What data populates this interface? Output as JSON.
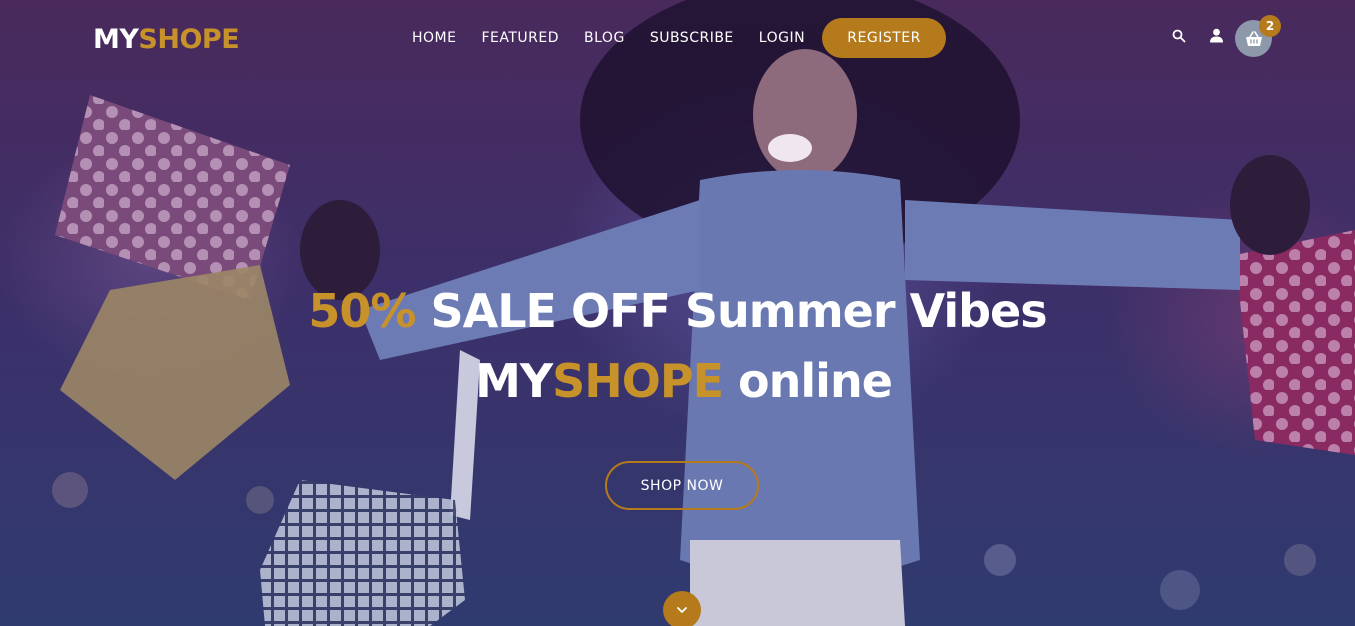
{
  "brand": {
    "part1": "MY",
    "part2": "SHOPE"
  },
  "nav": {
    "items": [
      {
        "label": "HOME"
      },
      {
        "label": "FEATURED"
      },
      {
        "label": "BLOG"
      },
      {
        "label": "SUBSCRIBE"
      },
      {
        "label": "LOGIN"
      }
    ],
    "register_label": "REGISTER"
  },
  "header_icons": {
    "search": "search-icon",
    "user": "user-icon",
    "cart": "shopping-basket-icon",
    "cart_count": "2"
  },
  "hero": {
    "line1_highlight": "50%",
    "line1_rest": " SALE OFF Summer Vibes",
    "line2_brand_a": "MY",
    "line2_brand_b": "SHOPE",
    "line2_rest": " online",
    "cta_label": "SHOP NOW",
    "scroll_icon": "chevron-down-icon"
  },
  "colors": {
    "accent": "#b47a1c",
    "accent_text": "#c8922a",
    "overlay": "#3d2f69",
    "text": "#ffffff"
  }
}
